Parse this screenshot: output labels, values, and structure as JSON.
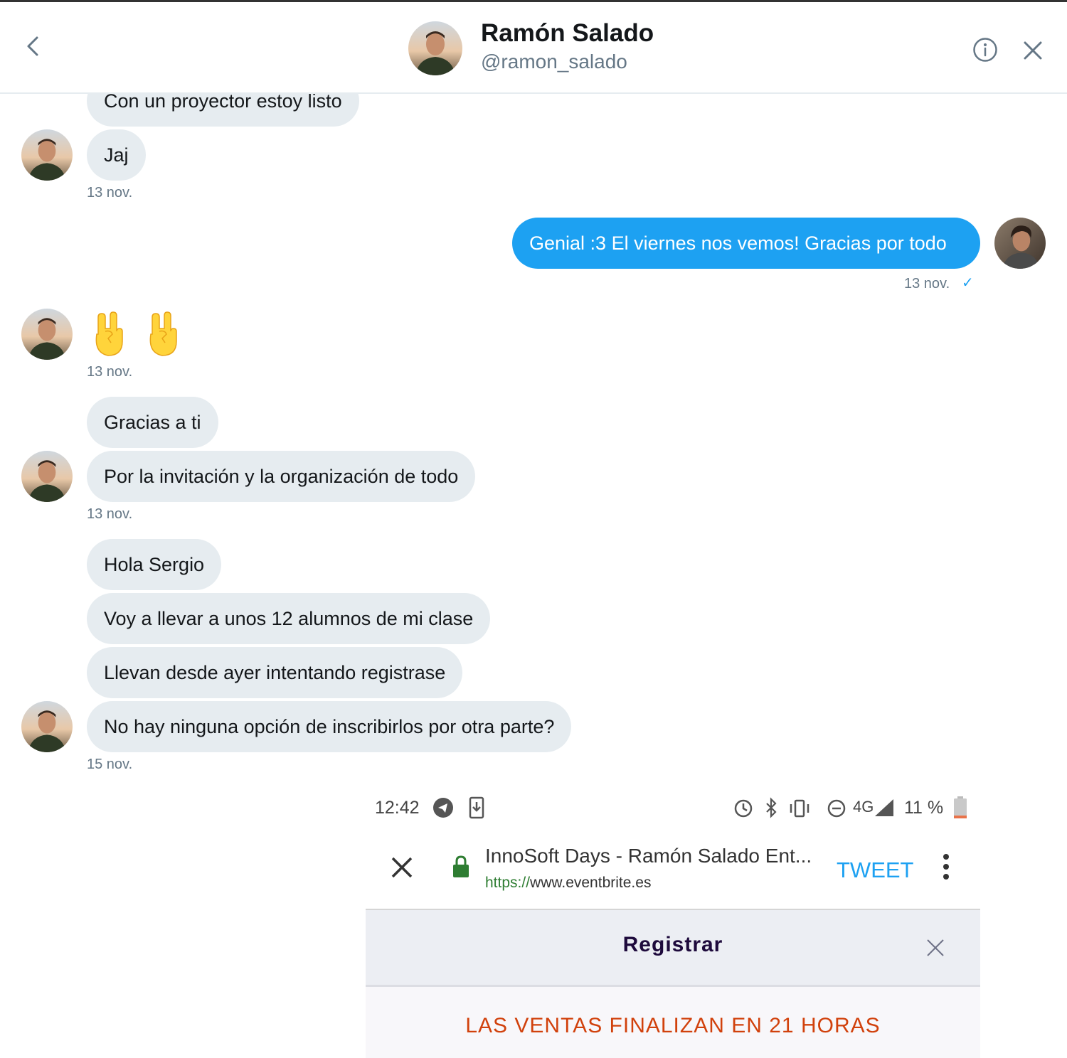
{
  "conversation": {
    "name": "Ramón Salado",
    "handle": "@ramon_salado"
  },
  "icons": {
    "back": "chevron-left-icon",
    "info": "info-icon",
    "close": "close-icon",
    "emoji": "sign-of-the-horns-emoji"
  },
  "messages": [
    {
      "text": "Con un proyector estoy listo",
      "direction": "in"
    },
    {
      "text": "Jaj",
      "direction": "in"
    },
    {
      "time": "13 nov."
    },
    {
      "text": "Genial :3 El viernes nos vemos! Gracias por todo",
      "direction": "out"
    },
    {
      "time": "13 nov.",
      "status": "✓"
    },
    {
      "emoji": "🤘🤘",
      "direction": "in"
    },
    {
      "time": "13 nov."
    },
    {
      "text": "Gracias a ti",
      "direction": "in"
    },
    {
      "text": "Por la invitación y la organización de todo",
      "direction": "in"
    },
    {
      "time": "13 nov."
    },
    {
      "text": "Hola Sergio",
      "direction": "in"
    },
    {
      "text": "Voy a llevar a unos 12 alumnos de mi clase",
      "direction": "in"
    },
    {
      "text": "Llevan desde ayer intentando registrase",
      "direction": "in"
    },
    {
      "text": "No hay ninguna opción de inscribirlos por otra parte?",
      "direction": "in"
    },
    {
      "time": "15 nov."
    }
  ],
  "screenshot": {
    "status_bar": {
      "time": "12:42",
      "network": "4G",
      "battery": "11 %"
    },
    "browser": {
      "title": "InnoSoft Days - Ramón Salado Ent...",
      "url_scheme": "https://",
      "url_host": "www.eventbrite.es",
      "action": "TWEET"
    },
    "modal": {
      "title": "Registrar",
      "banner": "LAS VENTAS FINALIZAN EN 21 HORAS"
    }
  },
  "colors": {
    "outgoing_bubble": "#1da1f2",
    "incoming_bubble": "#e6ecf0",
    "secondary_text": "#657786",
    "sales_banner": "#d1410c"
  }
}
